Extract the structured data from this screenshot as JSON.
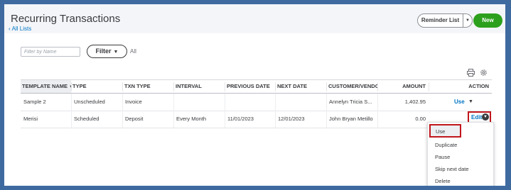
{
  "page": {
    "title": "Recurring Transactions",
    "back_link": "All Lists",
    "reminder_button": "Reminder List",
    "new_button": "New"
  },
  "filter": {
    "placeholder": "Filter by Name",
    "button_label": "Filter",
    "scope": "All"
  },
  "table": {
    "columns": [
      "TEMPLATE NAME",
      "TYPE",
      "TXN TYPE",
      "INTERVAL",
      "PREVIOUS DATE",
      "NEXT DATE",
      "CUSTOMER/VENDO",
      "AMOUNT",
      "ACTION"
    ],
    "rows": [
      {
        "template_name": "Sample 2",
        "type": "Unscheduled",
        "txn_type": "Invoice",
        "interval": "",
        "previous_date": "",
        "next_date": "",
        "customer": "Annelyn Tricia S...",
        "amount": "1,402.95",
        "action": "Use"
      },
      {
        "template_name": "Merisi",
        "type": "Scheduled",
        "txn_type": "Deposit",
        "interval": "Every Month",
        "previous_date": "11/01/2023",
        "next_date": "12/01/2023",
        "customer": "John Bryan Metillo",
        "amount": "0.00",
        "action": "Edit"
      }
    ]
  },
  "action_menu": {
    "items": [
      "Use",
      "Duplicate",
      "Pause",
      "Skip next date",
      "Delete"
    ]
  },
  "colors": {
    "accent_blue": "#0077c5",
    "new_green": "#2ca01c",
    "highlight_red": "#c0161c",
    "outer_border": "#3f6aa0"
  }
}
